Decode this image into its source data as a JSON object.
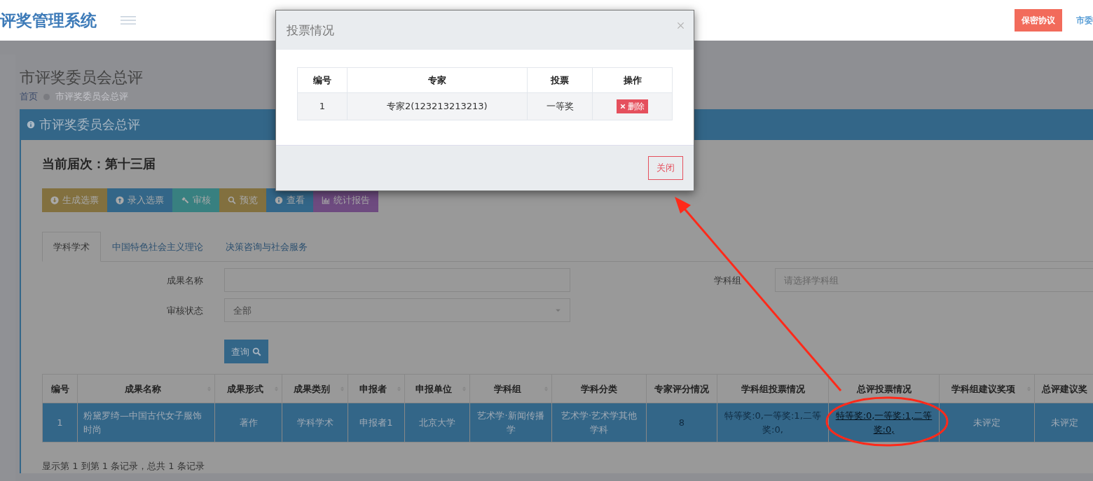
{
  "navbar": {
    "title": "评奖管理系统",
    "actions": [
      {
        "label": "保密协议",
        "kind": "button"
      },
      {
        "label": "市委",
        "kind": "link"
      }
    ]
  },
  "page": {
    "title": "市评奖委员会总评",
    "breadcrumb": [
      {
        "label": "首页",
        "current": false
      },
      {
        "label": "市评奖委员会总评",
        "current": true
      }
    ]
  },
  "panel": {
    "title": "市评奖委员会总评",
    "session": "当前届次：第十三届",
    "toolbar": [
      {
        "label": "生成选票",
        "kind": "generate",
        "color": "#82703f"
      },
      {
        "label": "录入选票",
        "kind": "import",
        "color": "#336688"
      },
      {
        "label": "审核",
        "kind": "review",
        "color": "#388080"
      },
      {
        "label": "预览",
        "kind": "preview",
        "color": "#82703f"
      },
      {
        "label": "查看",
        "kind": "view",
        "color": "#336688"
      },
      {
        "label": "统计报告",
        "kind": "report",
        "color": "#6e4b80"
      }
    ],
    "tabs": [
      {
        "label": "学科学术",
        "selected": true
      },
      {
        "label": "中国特色社会主义理论",
        "selected": false
      },
      {
        "label": "决策咨询与社会服务",
        "selected": false
      }
    ],
    "filters": [
      {
        "label": "成果名称",
        "kind": "text"
      },
      {
        "label": "学科组",
        "kind": "select",
        "placeholder": "请选择学科组"
      },
      {
        "label": "审核状态",
        "kind": "select",
        "value": "全部"
      }
    ],
    "search_button": "查询",
    "table": {
      "columns": [
        {
          "label": "编号",
          "sortable": false
        },
        {
          "label": "成果名称",
          "sortable": true
        },
        {
          "label": "成果形式",
          "sortable": true
        },
        {
          "label": "成果类别",
          "sortable": true
        },
        {
          "label": "申报者",
          "sortable": true
        },
        {
          "label": "申报单位",
          "sortable": true
        },
        {
          "label": "学科组",
          "sortable": true
        },
        {
          "label": "学科分类",
          "sortable": false
        },
        {
          "label": "专家评分情况",
          "sortable": false
        },
        {
          "label": "学科组投票情况",
          "sortable": false
        },
        {
          "label": "总评投票情况",
          "sortable": false
        },
        {
          "label": "学科组建议奖项",
          "sortable": true
        },
        {
          "label": "总评建议奖",
          "sortable": false
        }
      ],
      "rows": [
        {
          "selected": true,
          "cells": [
            {
              "text": "1",
              "kind": "text"
            },
            {
              "text": "粉黛罗绮—中国古代女子服饰时尚",
              "kind": "left"
            },
            {
              "text": "著作",
              "kind": "text"
            },
            {
              "text": "学科学术",
              "kind": "text"
            },
            {
              "text": "申报者1",
              "kind": "text"
            },
            {
              "text": "北京大学",
              "kind": "text"
            },
            {
              "text": "艺术学·新闻传播学",
              "kind": "text"
            },
            {
              "text": "艺术学·艺术学其他学科",
              "kind": "text"
            },
            {
              "text": "8",
              "kind": "faded"
            },
            {
              "text": "特等奖:0,一等奖:1,二等奖:0,",
              "kind": "faded"
            },
            {
              "text": "特等奖:0,一等奖:1,二等奖:0,",
              "kind": "link"
            },
            {
              "text": "未评定",
              "kind": "text"
            },
            {
              "text": "未评定",
              "kind": "text"
            }
          ]
        }
      ]
    },
    "footer": "显示第 1 到第 1 条记录，总共 1 条记录"
  },
  "modal": {
    "title": "投票情况",
    "columns": [
      "编号",
      "专家",
      "投票",
      "操作"
    ],
    "rows": [
      {
        "cells": [
          "1",
          "专家2(123213213213)",
          "一等奖"
        ],
        "action": "删除"
      }
    ],
    "close": "关闭"
  }
}
